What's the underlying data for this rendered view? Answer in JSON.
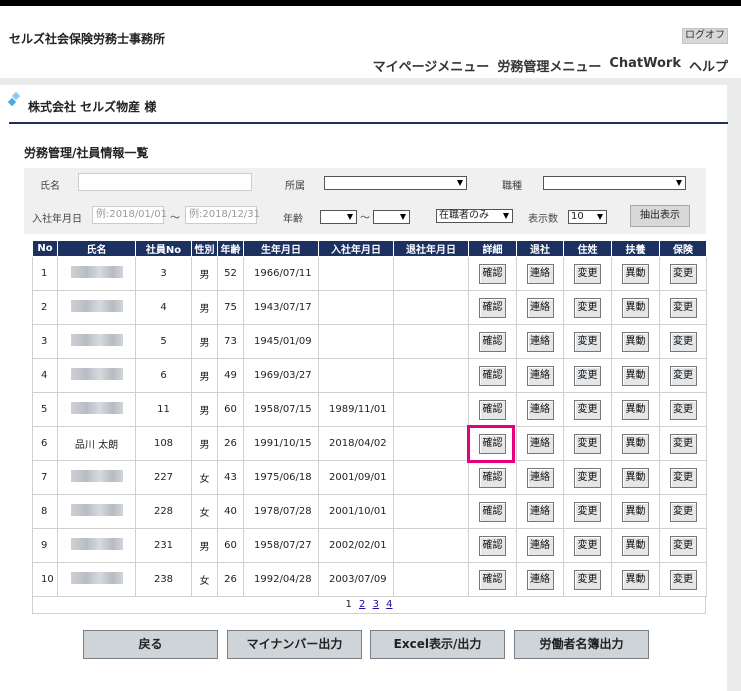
{
  "header": {
    "office_name": "セルズ社会保険労務士事務所",
    "logout_label": "ログオフ",
    "nav": [
      "マイページメニュー",
      "労務管理メニュー",
      "ChatWork",
      "ヘルプ"
    ]
  },
  "company": "株式会社 セルズ物産 様",
  "page_title": "労務管理/社員情報一覧",
  "search": {
    "name_label": "氏名",
    "dept_label": "所属",
    "job_label": "職種",
    "hire_label": "入社年月日",
    "hire_from_placeholder": "例:2018/01/01",
    "hire_to_placeholder": "例:2018/12/31",
    "range_sep": "～",
    "age_label": "年齢",
    "status_value": "在職者のみ",
    "count_label": "表示数",
    "count_value": "10",
    "extract_label": "抽出表示"
  },
  "table": {
    "headers": [
      "No",
      "氏名",
      "社員No",
      "性別",
      "年齢",
      "生年月日",
      "入社年月日",
      "退社年月日",
      "詳細",
      "退社",
      "住姓",
      "扶養",
      "保険"
    ],
    "action_labels": {
      "detail": "確認",
      "retire": "連絡",
      "address": "変更",
      "dependent": "異動",
      "insurance": "変更"
    },
    "rows": [
      {
        "no": "1",
        "name": "",
        "emp_no": "3",
        "sex": "男",
        "age": "52",
        "birth": "1966/07/11",
        "hired": "",
        "retired": ""
      },
      {
        "no": "2",
        "name": "",
        "emp_no": "4",
        "sex": "男",
        "age": "75",
        "birth": "1943/07/17",
        "hired": "",
        "retired": ""
      },
      {
        "no": "3",
        "name": "",
        "emp_no": "5",
        "sex": "男",
        "age": "73",
        "birth": "1945/01/09",
        "hired": "",
        "retired": ""
      },
      {
        "no": "4",
        "name": "",
        "emp_no": "6",
        "sex": "男",
        "age": "49",
        "birth": "1969/03/27",
        "hired": "",
        "retired": ""
      },
      {
        "no": "5",
        "name": "",
        "emp_no": "11",
        "sex": "男",
        "age": "60",
        "birth": "1958/07/15",
        "hired": "1989/11/01",
        "retired": ""
      },
      {
        "no": "6",
        "name": "品川 太朗",
        "emp_no": "108",
        "sex": "男",
        "age": "26",
        "birth": "1991/10/15",
        "hired": "2018/04/02",
        "retired": ""
      },
      {
        "no": "7",
        "name": "",
        "emp_no": "227",
        "sex": "女",
        "age": "43",
        "birth": "1975/06/18",
        "hired": "2001/09/01",
        "retired": ""
      },
      {
        "no": "8",
        "name": "",
        "emp_no": "228",
        "sex": "女",
        "age": "40",
        "birth": "1978/07/28",
        "hired": "2001/10/01",
        "retired": ""
      },
      {
        "no": "9",
        "name": "",
        "emp_no": "231",
        "sex": "男",
        "age": "60",
        "birth": "1958/07/27",
        "hired": "2002/02/01",
        "retired": ""
      },
      {
        "no": "10",
        "name": "",
        "emp_no": "238",
        "sex": "女",
        "age": "26",
        "birth": "1992/04/28",
        "hired": "2003/07/09",
        "retired": ""
      }
    ]
  },
  "pager": {
    "current": "1",
    "pages": [
      "2",
      "3",
      "4"
    ]
  },
  "footer_buttons": [
    "戻る",
    "マイナンバー出力",
    "Excel表示/出力",
    "労働者名簿出力"
  ],
  "colors": {
    "header_navy": "#1c3160",
    "highlight": "#e4007f"
  }
}
